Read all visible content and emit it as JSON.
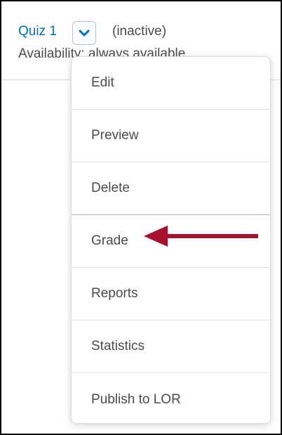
{
  "quiz": {
    "title": "Quiz 1",
    "status": "(inactive)",
    "availability": "Availability: always available"
  },
  "icons": {
    "context_menu": "chevron-down-icon",
    "annotation": "arrow-left-icon"
  },
  "colors": {
    "link": "#006fbf",
    "text": "#494c4e",
    "arrow": "#a8102e"
  },
  "menu": {
    "items": [
      {
        "label": "Edit"
      },
      {
        "label": "Preview"
      },
      {
        "label": "Delete"
      },
      {
        "label": "Grade"
      },
      {
        "label": "Reports"
      },
      {
        "label": "Statistics"
      },
      {
        "label": "Publish to LOR"
      }
    ]
  }
}
